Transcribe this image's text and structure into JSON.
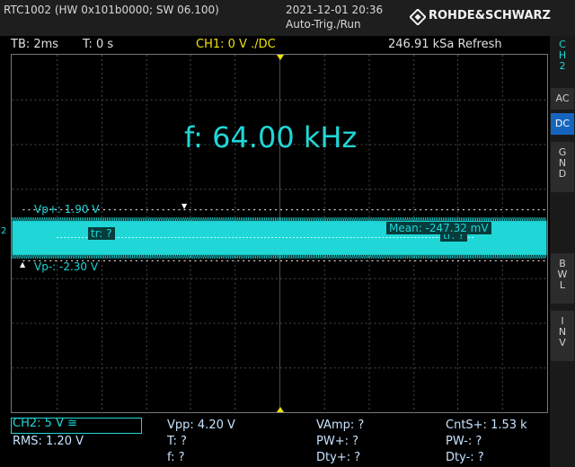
{
  "header": {
    "device_info": "RTC1002 (HW 0x101b0000; SW 06.100)",
    "datetime": "2021-12-01 20:36",
    "trigger_mode": "Auto-Trig./Run",
    "brand": "ROHDE&SCHWARZ"
  },
  "status": {
    "timebase": "TB: 2ms",
    "trigger_offset": "T: 0 s",
    "ch1": "CH1: 0 V ./DC",
    "sample_rate": "246.91 kSa Refresh"
  },
  "side_panel": {
    "channel": [
      "C",
      "H",
      "2"
    ],
    "ac": "AC",
    "dc": "DC",
    "gnd": [
      "G",
      "N",
      "D"
    ],
    "bwl": [
      "B",
      "W",
      "L"
    ],
    "inv": [
      "I",
      "N",
      "V"
    ]
  },
  "waveform": {
    "frequency": "f: 64.00 kHz",
    "vp_plus": "Vp+: 1.90 V",
    "vp_minus": "Vp-: -2.30 V",
    "tr1": "tr: ?",
    "tr2": "tr: ?",
    "mean": "Mean: -247.32 mV",
    "channel_marker": "2",
    "color": "#1fd7d7"
  },
  "measurements": {
    "ch2": "CH2: 5 V ≅",
    "rms": "RMS: 1.20 V",
    "vpp": "Vpp: 4.20 V",
    "t": "T: ?",
    "f": "f: ?",
    "vamp": "VAmp: ?",
    "pw_plus": "PW+: ?",
    "dty_plus": "Dty+: ?",
    "cnts_plus": "CntS+: 1.53 k",
    "pw_minus": "PW-: ?",
    "dty_minus": "Dty-: ?"
  }
}
